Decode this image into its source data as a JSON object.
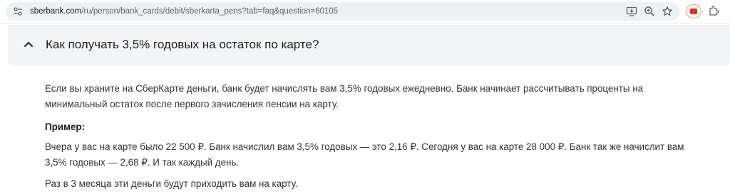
{
  "browser": {
    "url_host": "sberbank.com",
    "url_path": "/ru/person/bank_cards/debit/sberkarta_pens?tab=faq&question=60105",
    "icons": [
      "site-info-icon",
      "install-app-icon",
      "zoom-icon",
      "bookmark-star-icon",
      "youtube-extension-icon",
      "extensions-icon"
    ]
  },
  "faq": {
    "question": "Как получать 3,5% годовых на остаток по карте?",
    "expanded": true,
    "answer": {
      "paragraph_1": "Если вы храните на СберКарте деньги, банк будет начислять вам 3,5% годовых ежедневно. Банк начинает рассчитывать проценты на минимальный остаток после первого зачисления пенсии на карту.",
      "example_label": "Пример:",
      "paragraph_2": "Вчера у вас на карте было 22 500 ₽. Банк начислил вам 3,5% годовых — это 2,16 ₽. Сегодня у вас на карте 28 000 ₽. Банк так же начислит вам 3,5% годовых — 2,68 ₽. И так каждый день.",
      "paragraph_3": "Раз в 3 месяца эти деньги будут приходить вам на карту."
    }
  },
  "colors": {
    "card_background": "#f3f4f6",
    "text": "#333333",
    "youtube_red": "#d93025"
  }
}
